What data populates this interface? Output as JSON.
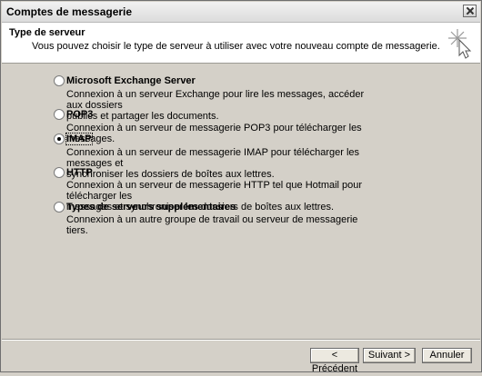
{
  "window": {
    "title": "Comptes de messagerie"
  },
  "header": {
    "title": "Type de serveur",
    "subtitle": "Vous pouvez choisir le type de serveur à utiliser avec votre nouveau compte de messagerie."
  },
  "options": [
    {
      "label": "Microsoft Exchange Server",
      "desc1": "Connexion à un serveur Exchange pour lire les messages, accéder aux dossiers",
      "desc2": "publics et partager les documents.",
      "selected": false
    },
    {
      "label": "POP3",
      "desc1": "Connexion à un serveur de messagerie POP3 pour télécharger les messages.",
      "desc2": "",
      "selected": false
    },
    {
      "label": "IMAP",
      "desc1": "Connexion à un serveur de messagerie IMAP pour télécharger les messages et",
      "desc2": "synchroniser les dossiers de boîtes aux lettres.",
      "selected": true
    },
    {
      "label": "HTTP",
      "desc1": "Connexion à un serveur de messagerie HTTP tel que Hotmail pour télécharger les",
      "desc2": "messages et synchroniser les dossiers de boîtes aux lettres.",
      "selected": false
    },
    {
      "label": "Types de serveurs supplémentaires",
      "desc1": "Connexion à un autre groupe de travail ou serveur de messagerie tiers.",
      "desc2": "",
      "selected": false
    }
  ],
  "buttons": {
    "back": "< Précédent",
    "next": "Suivant >",
    "cancel": "Annuler"
  },
  "icons": {
    "close": "close-icon",
    "wizard": "wizard-wand-icon"
  }
}
